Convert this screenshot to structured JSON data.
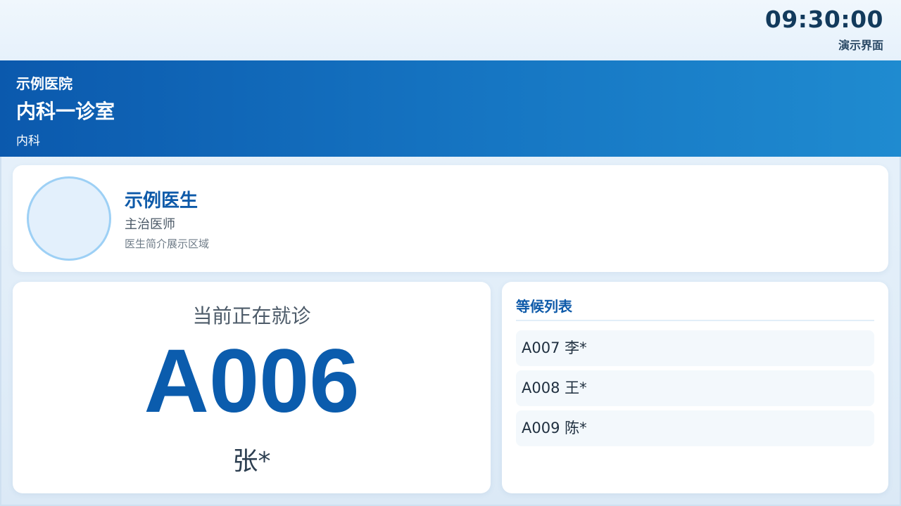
{
  "topbar": {
    "clock": "09:30:00",
    "mode_label": "演示界面"
  },
  "header": {
    "hospital": "示例医院",
    "room": "内科一诊室",
    "department": "内科"
  },
  "doctor": {
    "name": "示例医生",
    "title": "主治医师",
    "intro": "医生简介展示区域"
  },
  "current": {
    "label": "当前正在就诊",
    "number": "A006",
    "patient": "张*"
  },
  "waiting": {
    "title": "等候列表",
    "items": [
      {
        "text": "A007 李*"
      },
      {
        "text": "A008 王*"
      },
      {
        "text": "A009 陈*"
      }
    ]
  },
  "colors": {
    "brand_blue": "#0b5cad",
    "header_start": "#0b59ad",
    "header_end": "#1f8bd0"
  }
}
